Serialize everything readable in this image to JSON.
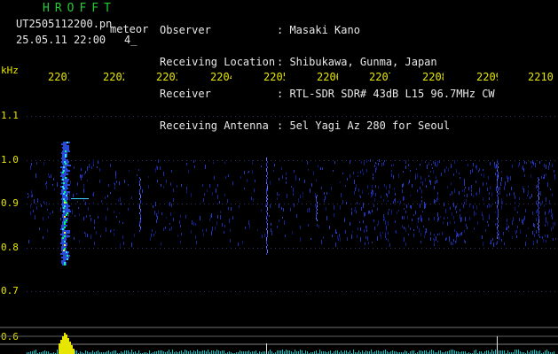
{
  "header": {
    "app_title": "HROFFT",
    "file_name": "UT2505112200.pn",
    "meteor_label": "meteor",
    "datetime": "25.05.11 22:00",
    "count": "4_"
  },
  "info": {
    "labels": [
      "Observer",
      "Receiving Location",
      "Receiver",
      "Receiving Antenna"
    ],
    "values": [
      ": Masaki Kano",
      ": Shibukawa, Gunma, Japan",
      ": RTL-SDR SDR# 43dB L15 96.7MHz CW",
      ": 5el Yagi Az 280 for Seoul"
    ]
  },
  "axis": {
    "freq_unit": "kHz",
    "freq_ticks": [
      "1.1",
      "1.0",
      "0.9",
      "0.8",
      "0.7",
      "0.6"
    ],
    "time_ticks": [
      "2201",
      "2202",
      "2203",
      "2204",
      "2205",
      "2206",
      "2207",
      "2208",
      "2209",
      "2210"
    ]
  },
  "colors": {
    "background": "#000000",
    "axis_text": "#e6e600",
    "title_green": "#22cc33",
    "header_text": "#e8e8e8",
    "dot_grid": "#303070",
    "noise": "#1a2a9a",
    "echo_core": "#00ff66",
    "spike": "#e6e600",
    "baseline": "#00c8c8"
  }
}
